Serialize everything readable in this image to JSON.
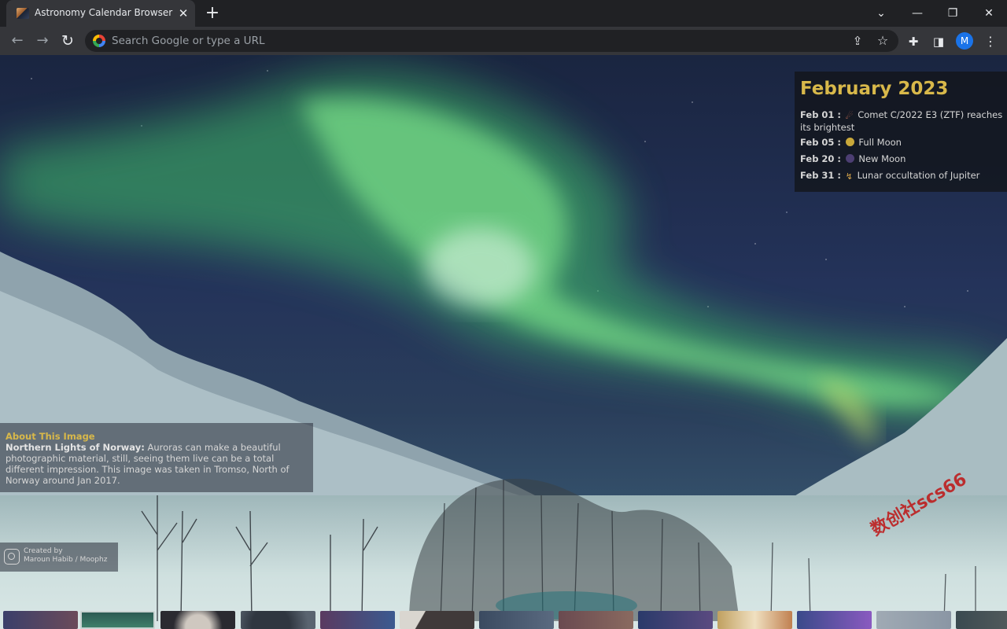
{
  "browser": {
    "tab_title": "Astronomy Calendar Browser Extension",
    "tab_close": "✕",
    "new_tab": "+",
    "window_controls": {
      "tab_search": "⌄",
      "minimize": "—",
      "maximize": "❐",
      "close": "✕"
    },
    "nav": {
      "back": "←",
      "forward": "→",
      "reload": "↻"
    },
    "omnibox_placeholder": "Search Google or type a URL",
    "profile_initial": "M",
    "icons": [
      "share-icon",
      "star-icon",
      "extensions-icon",
      "side-panel-icon",
      "menu-icon"
    ]
  },
  "calendar": {
    "month": "February 2023",
    "events": [
      {
        "date": "Feb 01 :",
        "icon": "comet-icon",
        "text": "Comet C/2022 E3 (ZTF) reaches its brightest"
      },
      {
        "date": "Feb 05 :",
        "icon": "full-moon-icon",
        "text": "Full Moon"
      },
      {
        "date": "Feb 20 :",
        "icon": "new-moon-icon",
        "text": "New Moon"
      },
      {
        "date": "Feb 31 :",
        "icon": "occultation-icon",
        "text": "Lunar occultation of Jupiter"
      }
    ],
    "colors": {
      "month": "#d8b84a",
      "full_moon": "#c9a83a",
      "new_moon": "#4c3e72"
    }
  },
  "about": {
    "heading": "About This Image",
    "title": "Northern Lights of Norway:",
    "description": "Auroras can make a beautiful photographic material, still, seeing them live can be a total different impression. This image was taken in Tromso, North of Norway around Jan 2017."
  },
  "credit": {
    "label": "Created by",
    "author": "Maroun Habib / Moophz"
  },
  "watermark": "数创社scs66",
  "thumbnails": [
    {
      "id": "thumb-1",
      "active": false
    },
    {
      "id": "thumb-2",
      "active": true
    },
    {
      "id": "thumb-3",
      "active": false
    },
    {
      "id": "thumb-4",
      "active": false
    },
    {
      "id": "thumb-5",
      "active": false
    },
    {
      "id": "thumb-6",
      "active": false
    },
    {
      "id": "thumb-7",
      "active": false
    },
    {
      "id": "thumb-8",
      "active": false
    },
    {
      "id": "thumb-9",
      "active": false
    },
    {
      "id": "thumb-10",
      "active": false
    },
    {
      "id": "thumb-11",
      "active": false
    },
    {
      "id": "thumb-12",
      "active": false
    },
    {
      "id": "thumb-13",
      "active": false
    }
  ]
}
